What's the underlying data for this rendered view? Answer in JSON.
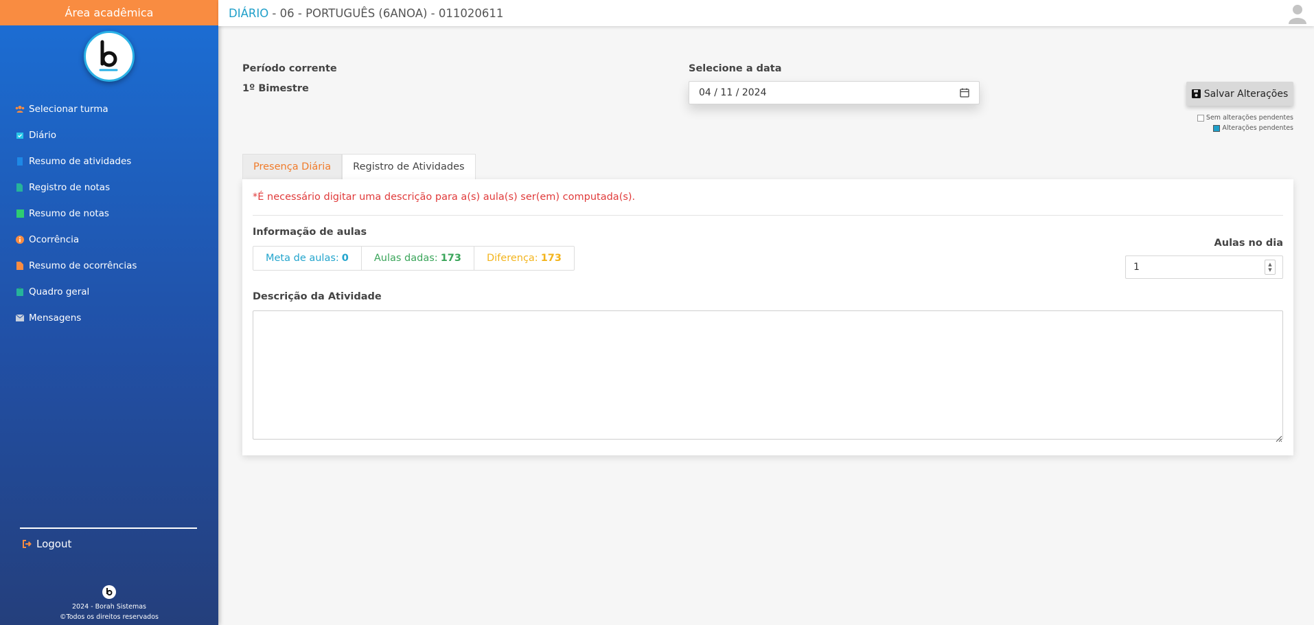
{
  "sidebar": {
    "header": "Área acadêmica",
    "items": [
      {
        "label": "Selecionar turma",
        "icon": "users-icon",
        "color": "#f98c41"
      },
      {
        "label": "Diário",
        "icon": "calendar-check-icon",
        "color": "#29c7e8"
      },
      {
        "label": "Resumo de atividades",
        "icon": "bookmark-icon",
        "color": "#1e88e5"
      },
      {
        "label": "Registro de notas",
        "icon": "file-edit-icon",
        "color": "#26b39a"
      },
      {
        "label": "Resumo de notas",
        "icon": "book-icon",
        "color": "#2ecc71"
      },
      {
        "label": "Ocorrência",
        "icon": "info-circle-icon",
        "color": "#f98c41"
      },
      {
        "label": "Resumo de ocorrências",
        "icon": "file-icon",
        "color": "#f98c41"
      },
      {
        "label": "Quadro geral",
        "icon": "clipboard-icon",
        "color": "#26b39a"
      },
      {
        "label": "Mensagens",
        "icon": "envelope-icon",
        "color": "#c8d0dc"
      }
    ],
    "logout": "Logout",
    "footer_line1": "2024 - Borah Sistemas",
    "footer_line2": "©Todos os direitos reservados"
  },
  "topbar": {
    "accent": "DIÁRIO",
    "rest": " - 06 - PORTUGUÊS (6ANOA) - 011020611"
  },
  "periodo": {
    "label": "Período corrente",
    "value": "1º Bimestre"
  },
  "date": {
    "label": "Selecione a data",
    "value": "04 / 11 / 2024"
  },
  "save_button": "Salvar Alterações",
  "legend": {
    "none": "Sem alterações pendentes",
    "pending": "Alterações pendentes",
    "pending_color": "#1f9fc9"
  },
  "tabs": [
    "Presença Diária",
    "Registro de Atividades"
  ],
  "panel": {
    "warning": "*É necessário digitar uma descrição para a(s) aula(s) ser(em) computada(s).",
    "info_label": "Informação de aulas",
    "meta_label": "Meta de aulas:",
    "meta_value": "0",
    "dadas_label": "Aulas dadas:",
    "dadas_value": "173",
    "dif_label": "Diferença:",
    "dif_value": "173",
    "aulas_dia_label": "Aulas no dia",
    "aulas_dia_value": "1",
    "desc_label": "Descrição da Atividade",
    "desc_value": ""
  }
}
